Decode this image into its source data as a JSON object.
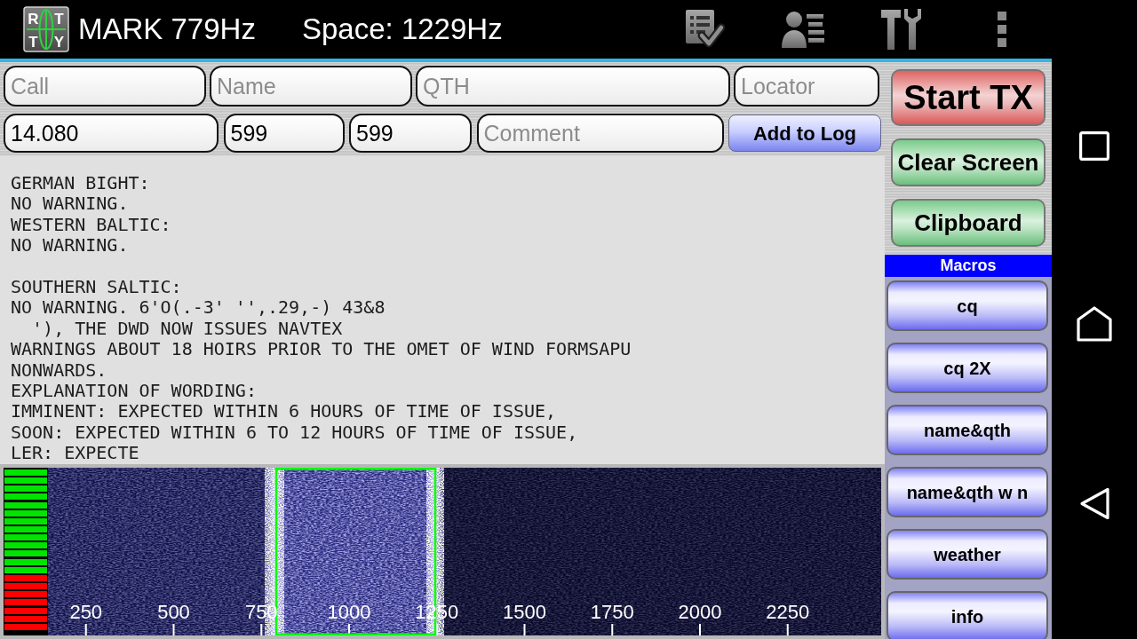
{
  "action_bar": {
    "logo_letters": [
      "R",
      "T",
      "T",
      "Y"
    ],
    "mark": "MARK 779Hz",
    "space": "Space: 1229Hz"
  },
  "log_form": {
    "rows": [
      [
        {
          "placeholder": "Call"
        },
        {
          "placeholder": "Name"
        },
        {
          "placeholder": "QTH"
        },
        {
          "placeholder": "Locator"
        }
      ],
      [
        {
          "value": "14.080"
        },
        {
          "value": "599"
        },
        {
          "value": "599"
        },
        {
          "placeholder": "Comment"
        }
      ]
    ],
    "button": "Add to Log"
  },
  "receive_text": {
    "blocks": [
      [
        "GERMAN BIGHT:",
        "NO WARNING.",
        "WESTERN BALTIC:",
        "NO WARNING."
      ],
      [
        "SOUTHERN SALTIC:",
        "NO WARNING. 6'O(.-3' '',.29,-) 43&8",
        "  '), THE DWD NOW ISSUES NAVTEX",
        "WARNINGS ABOUT 18 HOIRS PRIOR TO THE OMET OF WIND FORMSAPU",
        "NONWARDS.",
        "EXPLANATION OF WORDING:",
        "IMMINENT: EXPECTED WITHIN 6 HOURS OF TIME OF ISSUE,",
        "SOON: EXPECTED WITHIN 6 TO 12 HOURS OF TIME OF ISSUE,",
        "LER: EXPECTE"
      ]
    ]
  },
  "waterfall": {
    "signal_meter": {
      "level": 0.35
    },
    "scale_labels": [
      "250",
      "500",
      "750",
      "1000",
      "1250",
      "1500",
      "1750",
      "2000",
      "2250"
    ]
  },
  "controls": [
    {
      "label": "Start TX",
      "kind": "transmit"
    },
    {
      "label": "Clear Screen",
      "kind": "action"
    },
    {
      "label": "Clipboard",
      "kind": "action"
    }
  ],
  "macros": {
    "title": "Macros",
    "buttons": [
      "cq",
      "cq 2X",
      "name&qth",
      "name&qth w n",
      "weather",
      "info"
    ]
  }
}
